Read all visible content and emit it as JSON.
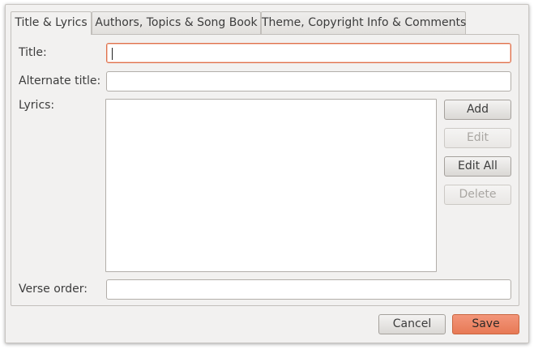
{
  "tabs": [
    {
      "label": "Title & Lyrics",
      "active": true
    },
    {
      "label": "Authors, Topics & Song Book",
      "active": false
    },
    {
      "label": "Theme, Copyright Info & Comments",
      "active": false
    }
  ],
  "form": {
    "title_label": "Title:",
    "title_value": "",
    "alternate_title_label": "Alternate title:",
    "alternate_title_value": "",
    "lyrics_label": "Lyrics:",
    "verse_order_label": "Verse order:",
    "verse_order_value": ""
  },
  "verse_buttons": {
    "add": "Add",
    "edit": "Edit",
    "edit_all": "Edit All",
    "delete": "Delete"
  },
  "dialog_buttons": {
    "cancel": "Cancel",
    "save": "Save"
  },
  "colors": {
    "focus_border": "#e0704b",
    "save_button": "#e77955"
  }
}
